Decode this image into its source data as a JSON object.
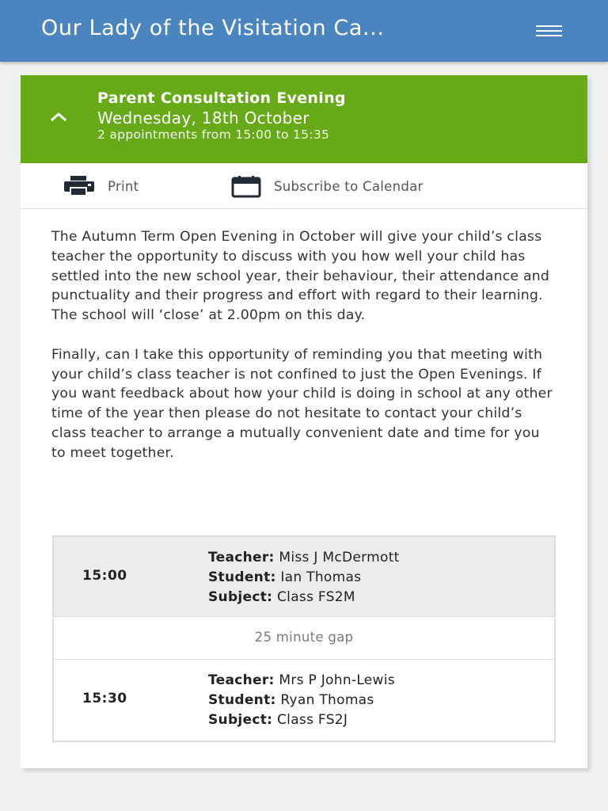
{
  "header": {
    "title": "Our Lady of the Visitation Ca...",
    "menu_icon": "hamburger-menu-icon"
  },
  "event": {
    "title": "Parent Consultation Evening",
    "date": "Wednesday, 18th October",
    "summary": "2 appointments from 15:00 to 15:35",
    "background": "#66aa17",
    "toggle_icon": "chevron-up-icon"
  },
  "actions": {
    "print_label": "Print",
    "print_icon": "printer-icon",
    "calendar_label": "Subscribe to Calendar",
    "calendar_icon": "calendar-icon"
  },
  "description": [
    "The Autumn Term Open Evening in October will give your child’s class teacher the opportunity to discuss with you how well your child has settled into the new school year, their behaviour, their attendance and punctuality and their progress and effort with regard to their learning. The school will ‘close’ at 2.00pm on this day.",
    "Finally, can I take this opportunity of reminding you that meeting with your child’s class teacher is not confined to just the Open Evenings. If you want feedback about how your child is doing in school at any other time of the year then please do not hesitate to contact your child’s class teacher to arrange a mutually convenient date and time for you to meet together."
  ],
  "labels": {
    "teacher": "Teacher:",
    "student": "Student:",
    "subject": "Subject:"
  },
  "appointments": [
    {
      "time": "15:00",
      "teacher": "Miss J McDermott",
      "student": "Ian Thomas",
      "subject": "Class FS2M"
    },
    {
      "time": "15:30",
      "teacher": "Mrs P John-Lewis",
      "student": "Ryan Thomas",
      "subject": "Class FS2J"
    }
  ],
  "gap": "25 minute gap",
  "colors": {
    "topbar": "#4a85bf",
    "event_header": "#66aa17",
    "page_background": "#eff0f2"
  }
}
